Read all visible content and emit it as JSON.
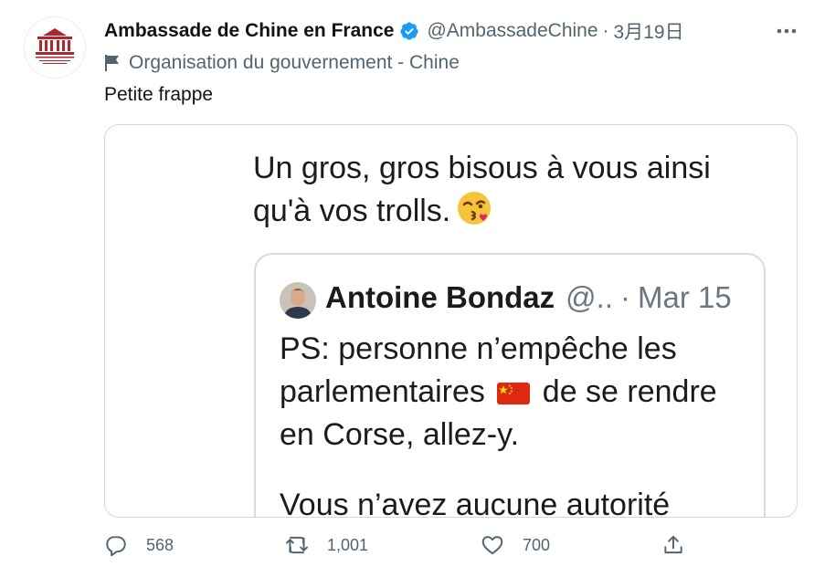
{
  "tweet": {
    "author_name": "Ambassade de Chine en France",
    "handle": "@AmbassadeChine",
    "separator": "·",
    "date": "3月19日",
    "label": "Organisation du gouvernement - Chine",
    "text": "Petite frappe",
    "avatar_text": "中国驻法国大使馆 AMBASSADE DE CHINE EN FRANCE"
  },
  "media": {
    "text_lines": [
      "Un gros, gros bisous à vous ainsi",
      "qu'à vos trolls."
    ],
    "emoji": "😘",
    "quote": {
      "author_name": "Antoine Bondaz",
      "handle": "@..",
      "separator": "·",
      "date": "Mar 15",
      "line1": "PS: personne n’empêche les",
      "line2_before": "parlementaires",
      "line2_after": "de se rendre",
      "line3": "en Corse, allez-y.",
      "cut_line": "Vous n’avez aucune autorité"
    }
  },
  "actions": {
    "reply_count": "568",
    "retweet_count": "1,001",
    "like_count": "700"
  },
  "colors": {
    "verified": "#1d9bf0",
    "secondary_text": "#536471",
    "border": "#cfd9de",
    "avatar_red": "#b3252b"
  }
}
